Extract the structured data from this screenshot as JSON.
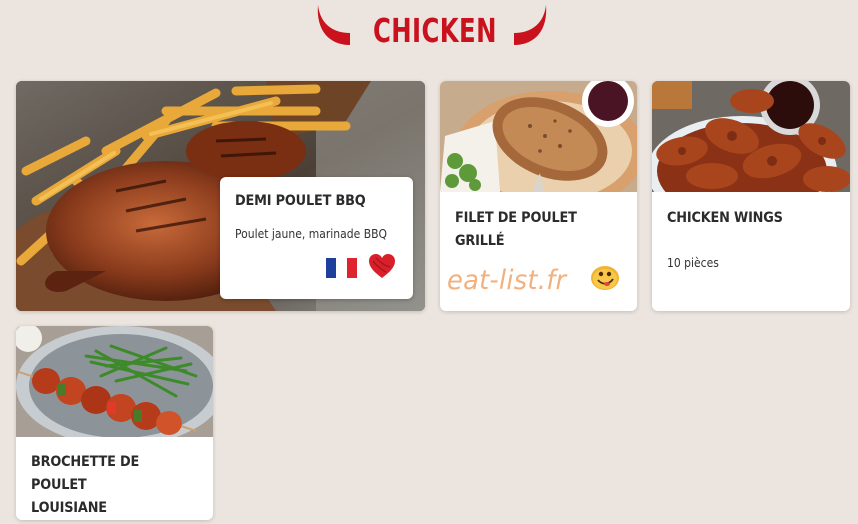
{
  "header": {
    "title": "CHICKEN",
    "accent_color": "#c9121e"
  },
  "items": [
    {
      "name": "DEMI POULET BBQ",
      "description": "Poulet jaune, marinade BBQ",
      "badges": [
        "france-flag-icon",
        "heart-icon"
      ],
      "image": "grilled-half-chicken-with-fries"
    },
    {
      "name": "FILET DE POULET GRILLÉ",
      "image": "grilled-chicken-breast-with-sauce"
    },
    {
      "name": "CHICKEN WINGS",
      "description": "10 pièces",
      "image": "chicken-wings-with-sauce"
    },
    {
      "name": "BROCHETTE DE POULET\nLOUISIANE",
      "image": "chicken-skewer-with-green-beans"
    }
  ],
  "watermark": {
    "text": "eat-list.fr",
    "icon": "smiley-icon"
  }
}
